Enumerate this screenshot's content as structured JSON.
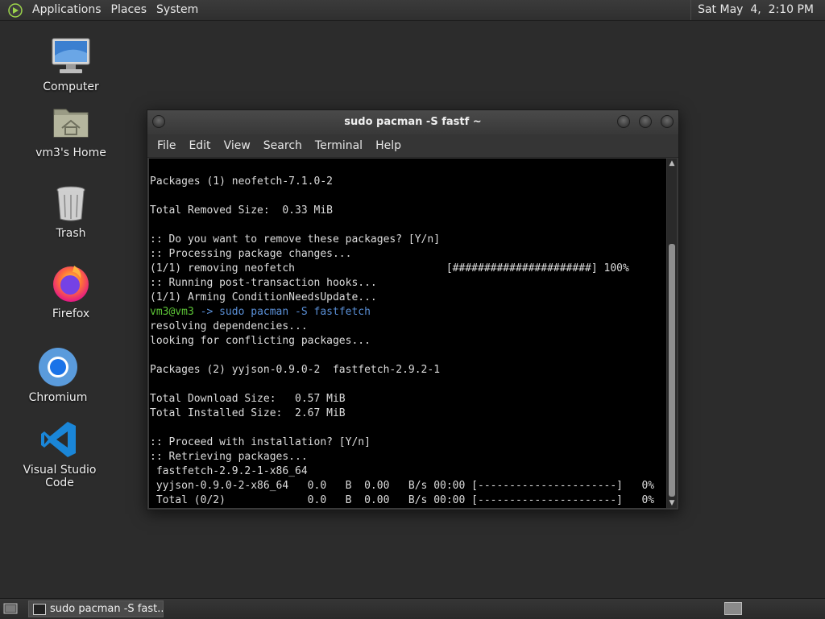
{
  "top_panel": {
    "menus": [
      "Applications",
      "Places",
      "System"
    ],
    "clock": "Sat May  4,  2:10 PM"
  },
  "desktop": {
    "icons": [
      {
        "label": "Computer",
        "icon": "computer-icon"
      },
      {
        "label": "vm3's Home",
        "icon": "home-folder-icon"
      },
      {
        "label": "Trash",
        "icon": "trash-icon"
      },
      {
        "label": "Firefox",
        "icon": "firefox-icon"
      },
      {
        "label": "Chromium",
        "icon": "chromium-icon"
      },
      {
        "label": "Visual Studio Code",
        "icon": "vscode-icon"
      }
    ]
  },
  "terminal": {
    "title": "sudo pacman -S fastf ~",
    "menu": [
      "File",
      "Edit",
      "View",
      "Search",
      "Terminal",
      "Help"
    ],
    "lines": [
      "Packages (1) neofetch-7.1.0-2",
      "",
      "Total Removed Size:  0.33 MiB",
      "",
      ":: Do you want to remove these packages? [Y/n]",
      ":: Processing package changes...",
      "(1/1) removing neofetch                        [######################] 100%",
      ":: Running post-transaction hooks...",
      "(1/1) Arming ConditionNeedsUpdate...",
      "",
      "resolving dependencies...",
      "looking for conflicting packages...",
      "",
      "Packages (2) yyjson-0.9.0-2  fastfetch-2.9.2-1",
      "",
      "Total Download Size:   0.57 MiB",
      "Total Installed Size:  2.67 MiB",
      "",
      ":: Proceed with installation? [Y/n]",
      ":: Retrieving packages...",
      " fastfetch-2.9.2-1-x86_64",
      " yyjson-0.9.0-2-x86_64   0.0   B  0.00   B/s 00:00 [----------------------]   0%",
      " Total (0/2)             0.0   B  0.00   B/s 00:00 [----------------------]   0%"
    ],
    "prompt": {
      "user_host": "vm3@vm3",
      "arrow": " -> ",
      "command": "sudo pacman -S fastfetch"
    }
  },
  "taskbar": {
    "task_label": "sudo pacman -S fast..."
  },
  "colors": {
    "desktop_bg": "#2c2c2c",
    "prompt_user": "#5bc236",
    "prompt_command": "#5a8fd6"
  }
}
